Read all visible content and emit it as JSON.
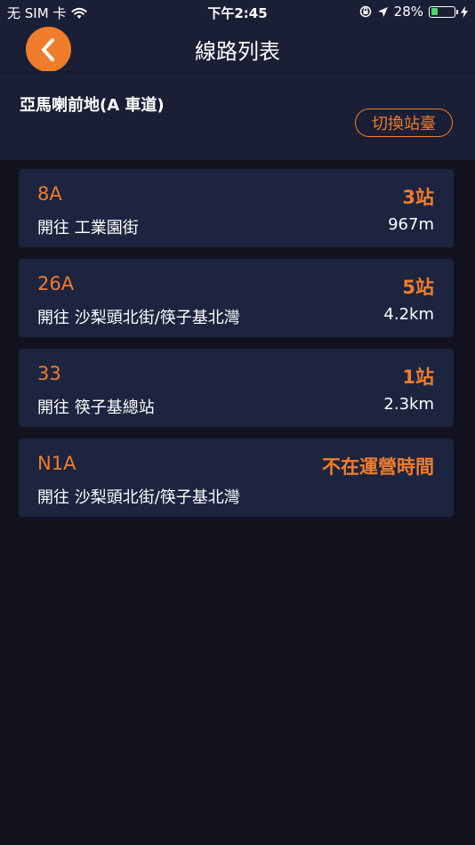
{
  "status_bar": {
    "carrier": "无 SIM 卡",
    "time": "下午2:45",
    "battery_percent": "28%",
    "battery_level": 0.28
  },
  "nav": {
    "title": "線路列表",
    "back_icon": "chevron-left-icon"
  },
  "stop": {
    "name": "亞馬喇前地(A 車道)",
    "switch_label": "切換站臺"
  },
  "colors": {
    "accent": "#ef7d2c",
    "header_bg": "#1a1f36",
    "card_bg": "#1c2440",
    "page_bg": "#12131e"
  },
  "routes": [
    {
      "number": "8A",
      "stops": "3站",
      "destination": "開往 工業園街",
      "distance": "967m"
    },
    {
      "number": "26A",
      "stops": "5站",
      "destination": "開往 沙梨頭北街/筷子基北灣",
      "distance": "4.2km"
    },
    {
      "number": "33",
      "stops": "1站",
      "destination": "開往 筷子基總站",
      "distance": "2.3km"
    },
    {
      "number": "N1A",
      "stops": "不在運營時間",
      "destination": "開往 沙梨頭北街/筷子基北灣",
      "distance": ""
    }
  ]
}
